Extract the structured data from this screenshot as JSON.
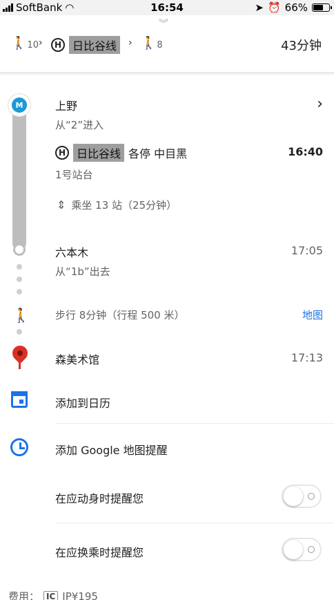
{
  "status": {
    "carrier": "SoftBank",
    "time": "16:54",
    "battery": "66%",
    "battery_level": 0.66
  },
  "route": {
    "walk1_min": "10",
    "line_badge": "H",
    "line_name": "日比谷线",
    "walk2_min": "8",
    "duration": "43分钟"
  },
  "stops": {
    "start_name": "上野",
    "start_sub": "从“2”进入",
    "line_name": "日比谷线",
    "line_info": "各停 中目黑",
    "depart_time": "16:40",
    "platform": "1号站台",
    "ride_info": "乘坐 13 站（25分钟）",
    "end_name": "六本木",
    "end_time": "17:05",
    "end_sub": "从“1b”出去"
  },
  "walk": {
    "text": "步行 8分钟（行程 500 米）",
    "map_link": "地图"
  },
  "destination": {
    "name": "森美术馆",
    "time": "17:13"
  },
  "actions": {
    "add_calendar": "添加到日历",
    "add_reminder": "添加 Google 地图提醒",
    "remind_depart": "在应动身时提醒您",
    "remind_transfer": "在应换乘时提醒您"
  },
  "fee": {
    "label": "费用：",
    "ic": "IC",
    "amount": "JP¥195"
  },
  "colors": {
    "accent": "#1a73e8",
    "pin": "#d93025",
    "line": "#bdbdbd",
    "metro": "#1b9ad6"
  },
  "logo_text": "M"
}
